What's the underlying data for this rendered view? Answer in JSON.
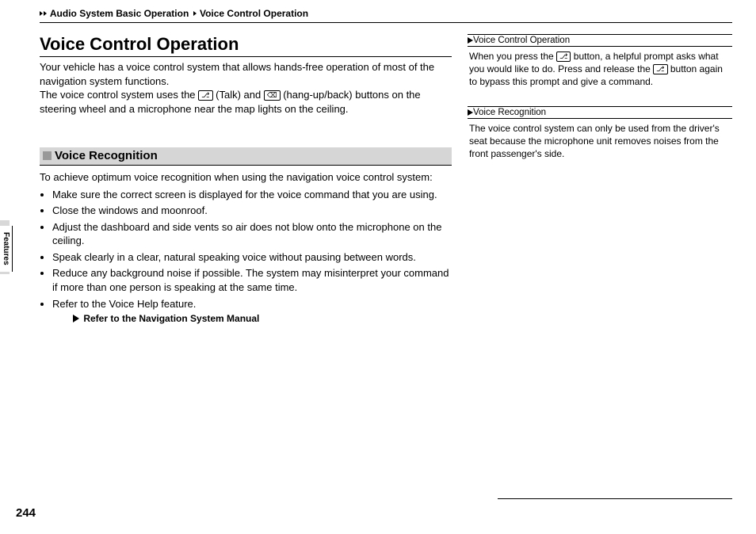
{
  "breadcrumb": {
    "part1": "Audio System Basic Operation",
    "part2": "Voice Control Operation"
  },
  "title": "Voice Control Operation",
  "intro": {
    "line1": "Your vehicle has a voice control system that allows hands-free operation of most of the navigation system functions.",
    "line2a": "The voice control system uses the ",
    "talk_label": " (Talk) and ",
    "line2b": " (hang-up/back) buttons on the steering wheel and a microphone near the map lights on the ceiling."
  },
  "section": {
    "title": "Voice Recognition",
    "lead": "To achieve optimum voice recognition when using the navigation voice control system:",
    "bullets": [
      "Make sure the correct screen is displayed for the voice command that you are using.",
      "Close the windows and moonroof.",
      "Adjust the dashboard and side vents so air does not blow onto the microphone on the ceiling.",
      "Speak clearly in a clear, natural speaking voice without pausing between words.",
      "Reduce any background noise if possible. The system may misinterpret your command if more than one person is speaking at the same time.",
      "Refer to the Voice Help feature."
    ],
    "reference": "Refer to the Navigation System Manual"
  },
  "sidebar": {
    "box1": {
      "title": "Voice Control Operation",
      "body_a": "When you press the ",
      "body_b": " button, a helpful prompt asks what you would like to do. Press and release the ",
      "body_c": " button again to bypass this prompt and give a command."
    },
    "box2": {
      "title": "Voice Recognition",
      "body": "The voice control system can only be used from the driver's seat because the microphone unit removes noises from the front passenger's side."
    }
  },
  "tab_label": "Features",
  "page_number": "244"
}
